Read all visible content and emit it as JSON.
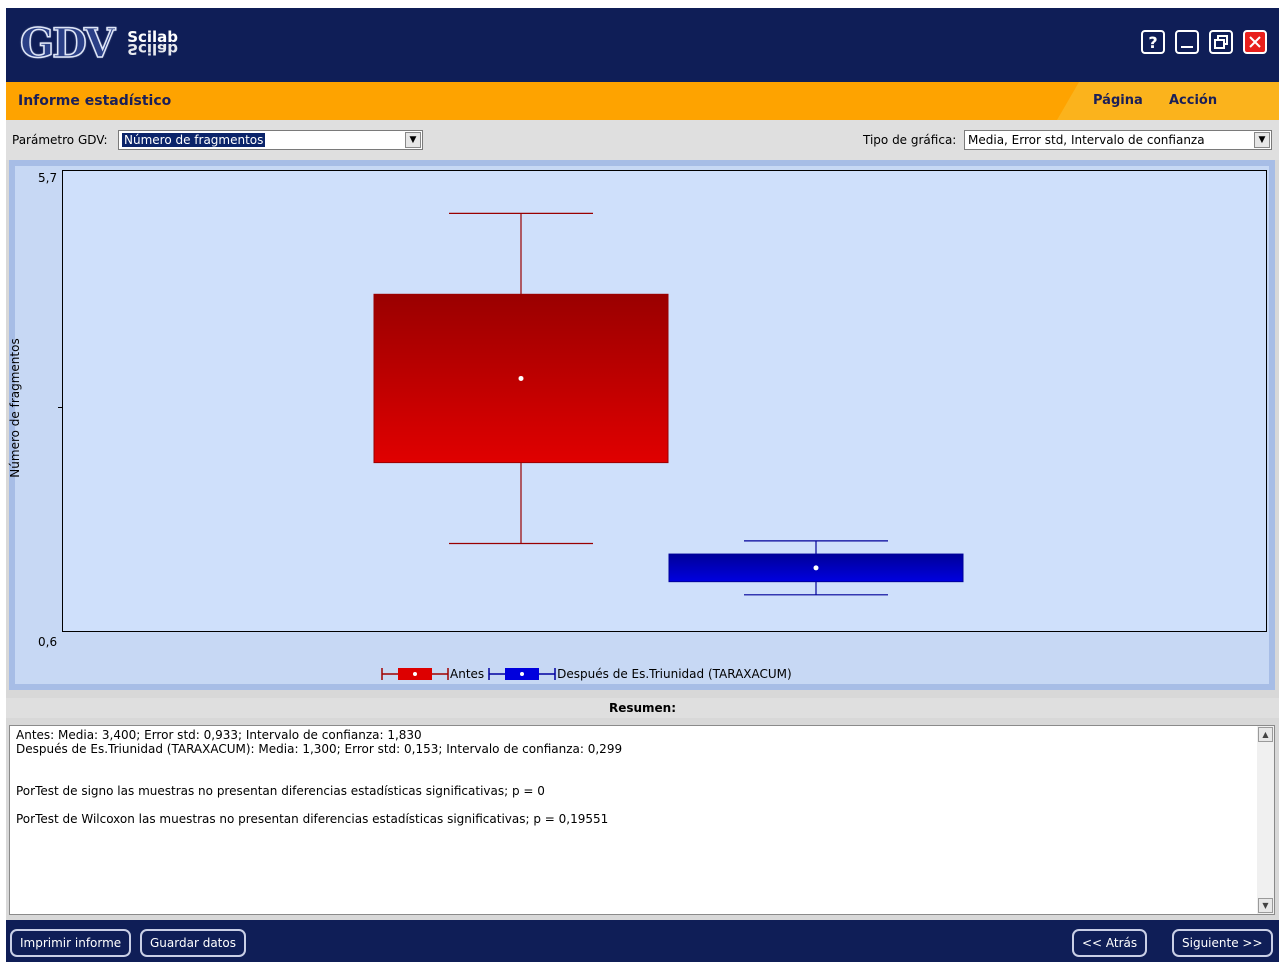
{
  "app": {
    "logo_text": "GDV",
    "logo_brand": "Scilab"
  },
  "window_buttons": {
    "help": "?",
    "minimize": "_",
    "restore": "❐",
    "close": "✕"
  },
  "header": {
    "title": "Informe estadístico",
    "menu": [
      "Página",
      "Acción"
    ]
  },
  "params": {
    "param_label": "Parámetro GDV:",
    "param_value": "Número de fragmentos",
    "chart_type_label": "Tipo de gráfica:",
    "chart_type_value": "Media, Error std, Intervalo de confianza"
  },
  "chart_data": {
    "type": "box",
    "ylabel": "Número de fragmentos",
    "ylim": [
      0.6,
      5.7
    ],
    "ytick_labels": [
      "5,7",
      "0,6"
    ],
    "series": [
      {
        "name": "Antes",
        "mean": 3.4,
        "std_error": 0.933,
        "confidence_interval": 1.83,
        "color": "#e00000"
      },
      {
        "name": "Después de Es.Triunidad (TARAXACUM)",
        "mean": 1.3,
        "std_error": 0.153,
        "confidence_interval": 0.299,
        "color": "#0000e0"
      }
    ],
    "legend_position": "bottom-center"
  },
  "summary": {
    "title": "Resumen:",
    "lines": [
      "Antes: Media: 3,400; Error std: 0,933; Intervalo de confianza: 1,830",
      "Después de Es.Triunidad (TARAXACUM): Media: 1,300; Error std: 0,153; Intervalo de confianza: 0,299",
      "",
      "",
      "PorTest de signo las muestras no presentan diferencias estadísticas significativas; p = 0",
      "",
      "PorTest de Wilcoxon las muestras no presentan diferencias estadísticas significativas; p = 0,19551"
    ]
  },
  "footer": {
    "print": "Imprimir informe",
    "save": "Guardar datos",
    "back": "<< Atrás",
    "next": "Siguiente >>"
  }
}
